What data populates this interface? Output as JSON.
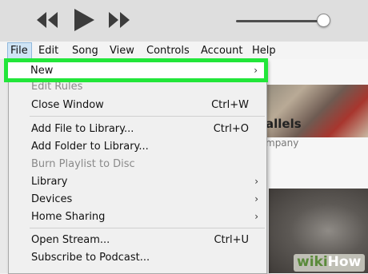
{
  "menubar": {
    "items": [
      "File",
      "Edit",
      "Song",
      "View",
      "Controls",
      "Account",
      "Help"
    ]
  },
  "file_menu": {
    "items": [
      {
        "label": "New",
        "shortcut": "",
        "submenu": true
      },
      {
        "label": "Edit Rules",
        "shortcut": "",
        "submenu": false,
        "disabled": true
      },
      {
        "label": "Close Window",
        "shortcut": "Ctrl+W",
        "submenu": false
      },
      {
        "label": "Add File to Library...",
        "shortcut": "Ctrl+O",
        "submenu": false
      },
      {
        "label": "Add Folder to Library...",
        "shortcut": "",
        "submenu": false
      },
      {
        "label": "Burn Playlist to Disc",
        "shortcut": "",
        "submenu": false,
        "disabled": true
      },
      {
        "label": "Library",
        "shortcut": "",
        "submenu": true
      },
      {
        "label": "Devices",
        "shortcut": "",
        "submenu": true
      },
      {
        "label": "Home Sharing",
        "shortcut": "",
        "submenu": true
      },
      {
        "label": "Open Stream...",
        "shortcut": "Ctrl+U",
        "submenu": false
      },
      {
        "label": "Subscribe to Podcast...",
        "shortcut": "",
        "submenu": false
      }
    ],
    "arrow_glyph": "›",
    "highlight_color": "#22e63a"
  },
  "background": {
    "album_title": "allels",
    "album_artist": "mpany"
  },
  "watermark": {
    "wiki": "wiki",
    "how": "How"
  },
  "icons": {
    "previous": "previous-icon",
    "play": "play-icon",
    "next": "next-icon",
    "submenu": "chevron-right-icon"
  }
}
